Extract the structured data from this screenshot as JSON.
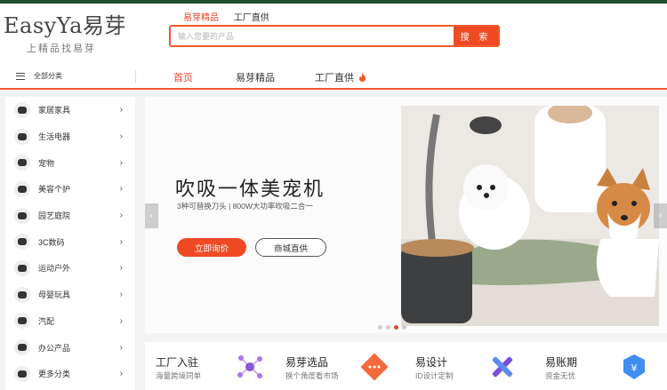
{
  "logo": {
    "brand_en": "EasyYa",
    "brand_cn": "易芽",
    "slogan": "上精品找易芽"
  },
  "search": {
    "tabs": [
      {
        "label": "易芽精品",
        "active": true
      },
      {
        "label": "工厂直供",
        "active": false
      }
    ],
    "placeholder": "输入您要的产品",
    "button_label": "搜 索"
  },
  "nav": {
    "all_categories": "全部分类",
    "links": [
      {
        "label": "首页",
        "active": true
      },
      {
        "label": "易芽精品",
        "active": false
      },
      {
        "label": "工厂直供",
        "active": false,
        "icon": "flame-icon"
      }
    ]
  },
  "sidebar": {
    "items": [
      {
        "label": "家居家具",
        "icon": "furniture-icon"
      },
      {
        "label": "生活电器",
        "icon": "appliance-icon"
      },
      {
        "label": "宠物",
        "icon": "pet-icon"
      },
      {
        "label": "美容个护",
        "icon": "beauty-icon"
      },
      {
        "label": "园艺庭院",
        "icon": "garden-icon"
      },
      {
        "label": "3C数码",
        "icon": "digital-icon"
      },
      {
        "label": "运动户外",
        "icon": "sports-icon"
      },
      {
        "label": "母婴玩具",
        "icon": "baby-icon"
      },
      {
        "label": "汽配",
        "icon": "auto-icon"
      },
      {
        "label": "办公产品",
        "icon": "office-icon"
      },
      {
        "label": "更多分类",
        "icon": "more-icon"
      }
    ],
    "arrow": "›"
  },
  "banner": {
    "title": "吹吸一体美宠机",
    "subtitle": "3种可替换刀头 | 800W大功率吹吸二合一",
    "primary_button": "立即询价",
    "secondary_button": "商城直供",
    "prev_arrow": "‹",
    "next_arrow": "›",
    "slide_count": 4,
    "active_slide": 3
  },
  "services": [
    {
      "title": "工厂入驻",
      "desc": "海量跨境同单",
      "icon": "network-icon"
    },
    {
      "title": "易芽选品",
      "desc": "换个角度看市场",
      "icon": "select-diamond-icon"
    },
    {
      "title": "易设计",
      "desc": "ID设计定制",
      "icon": "design-icon"
    },
    {
      "title": "易账期",
      "desc": "资金无忧",
      "icon": "yuan-shield-icon"
    }
  ],
  "colors": {
    "accent": "#f04a25",
    "topbar": "#1f4d2e"
  }
}
